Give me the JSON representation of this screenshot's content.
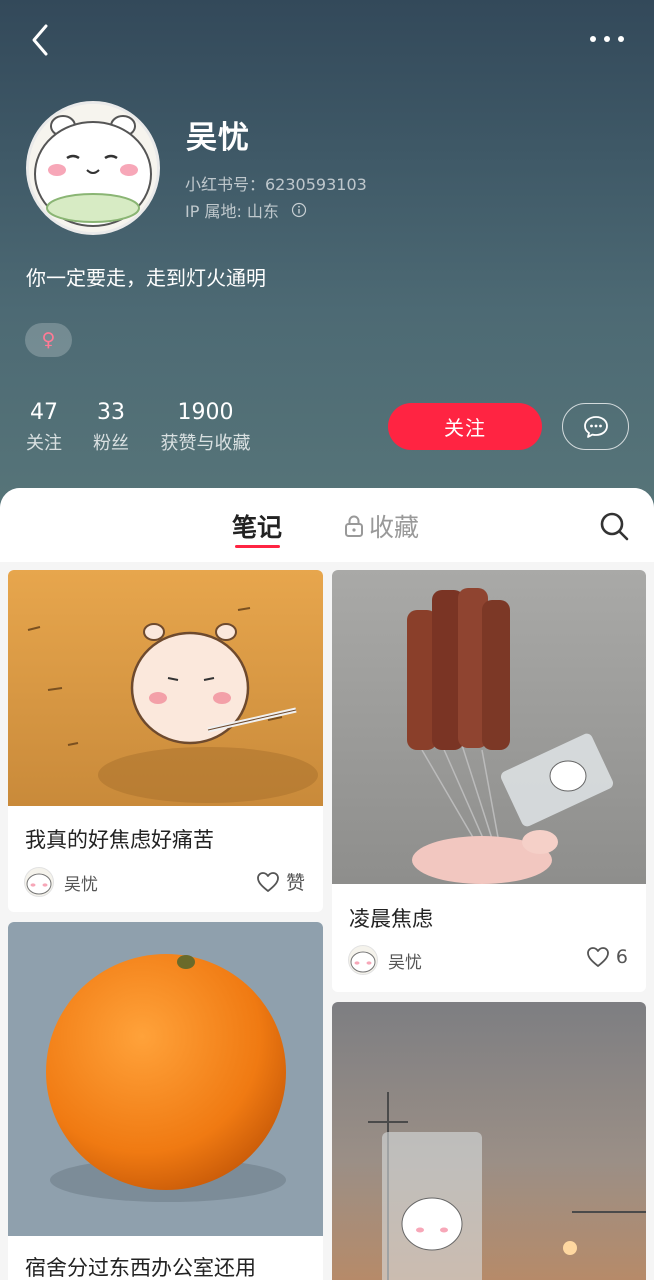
{
  "profile": {
    "name": "吴忧",
    "id_text": "小红书号：6230593103",
    "ip_text": "IP 属地: 山东",
    "bio": "你一定要走，走到灯火通明",
    "gender_symbol": "♀"
  },
  "stats": [
    {
      "value": "47",
      "label": "关注"
    },
    {
      "value": "33",
      "label": "粉丝"
    },
    {
      "value": "1900",
      "label": "获赞与收藏"
    }
  ],
  "actions": {
    "follow_label": "关注"
  },
  "tabs": {
    "notes": "笔记",
    "collections": "收藏"
  },
  "notes": [
    {
      "title": "我真的好焦虑好痛苦",
      "author": "吴忧",
      "likes": "赞"
    },
    {
      "title": "凌晨焦虑",
      "author": "吴忧",
      "likes": "6"
    },
    {
      "title": "宿舍分过东西办公室还用"
    }
  ],
  "colors": {
    "accent": "#ff2442",
    "header_top": "#33495a",
    "header_bottom": "#577579"
  },
  "icons": [
    "back-icon",
    "more-icon",
    "info-icon",
    "chat-icon",
    "lock-icon",
    "search-icon",
    "heart-icon"
  ]
}
